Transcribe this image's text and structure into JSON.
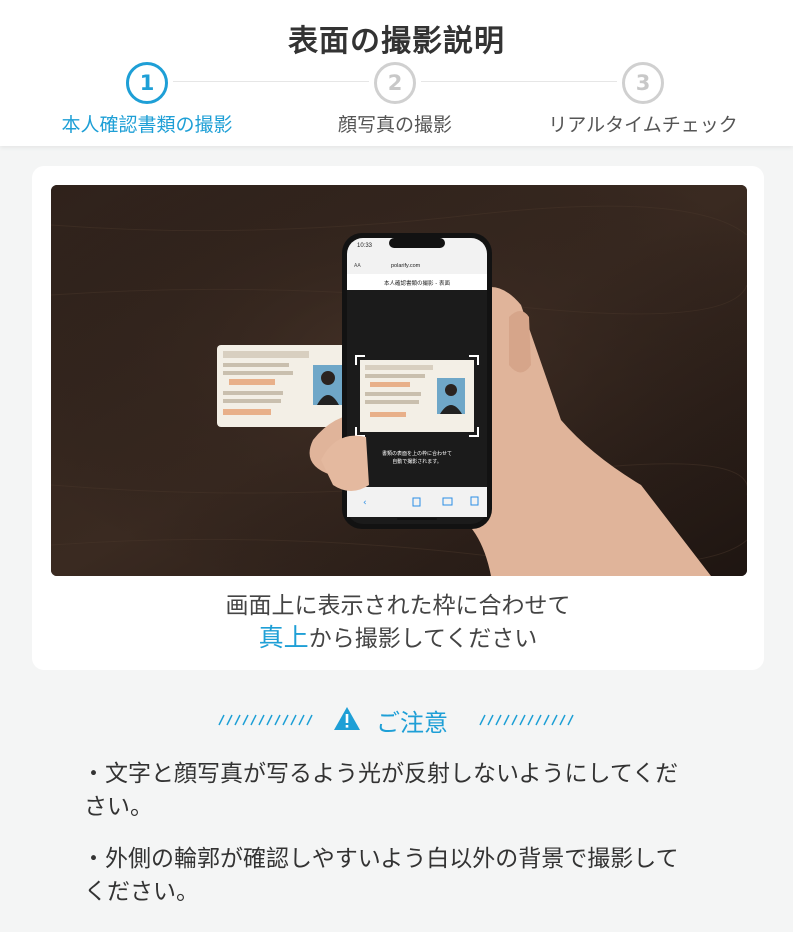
{
  "header": {
    "title": "表面の撮影説明",
    "steps": [
      {
        "number": "1",
        "label": "本人確認書類の撮影"
      },
      {
        "number": "2",
        "label": "顔写真の撮影"
      },
      {
        "number": "3",
        "label": "リアルタイムチェック"
      }
    ],
    "active_step": 1
  },
  "photo": {
    "phone_time": "10:33",
    "phone_url": "polarify.com",
    "phone_aa": "AA",
    "phone_screen_title": "本人確認書類の撮影 - 表面",
    "phone_instruction_line1": "書類の表面を上の枠に合わせて",
    "phone_instruction_line2": "自動で撮影されます。"
  },
  "instruction": {
    "line1": "画面上に表示された枠に合わせて",
    "highlight": "真上",
    "line2_rest": "から撮影してください"
  },
  "notice": {
    "title": "ご注意",
    "items": [
      {
        "line1": "・文字と顔写真が写るよう光が反射しないようにしてくだ",
        "line2": "さい。"
      },
      {
        "line1": "・外側の輪郭が確認しやすいよう白以外の背景で撮影して",
        "line2": "ください。"
      }
    ]
  },
  "colors": {
    "accent": "#1e9fd6",
    "inactive": "#c8c8c8",
    "background": "#f4f5f5"
  }
}
